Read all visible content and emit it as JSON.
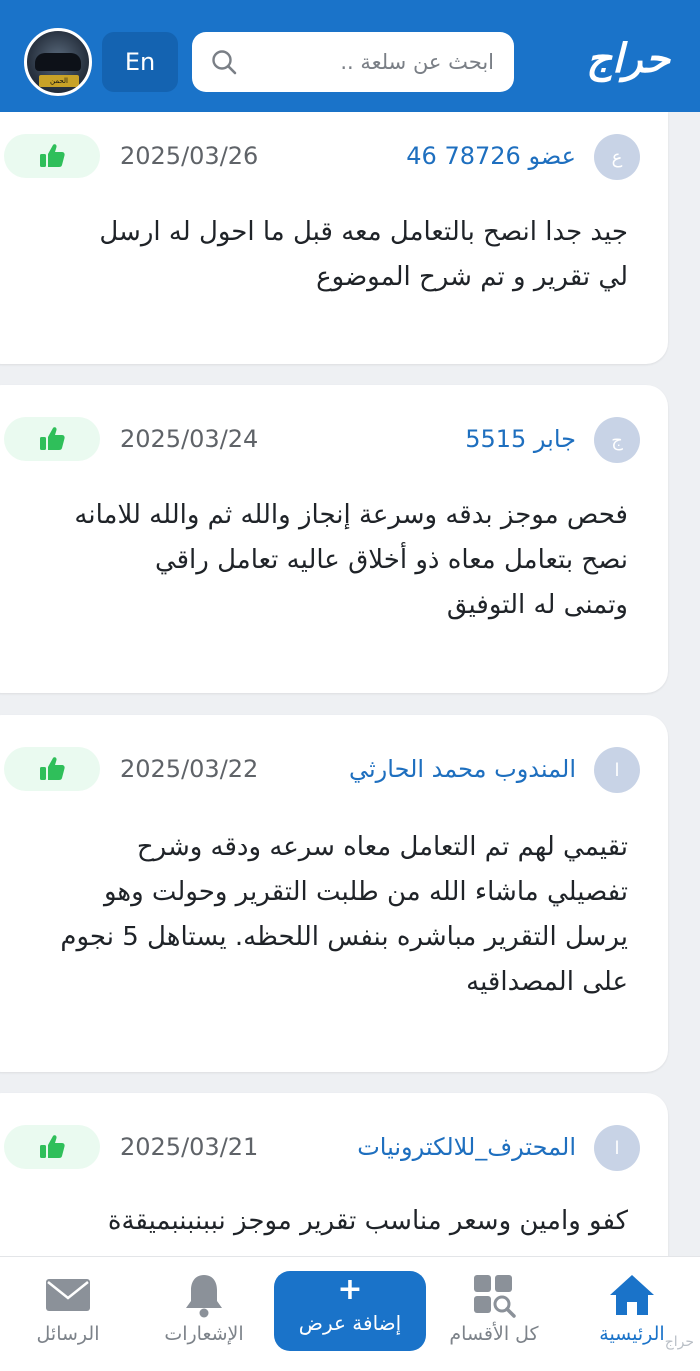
{
  "header": {
    "logo": "حراج",
    "search_placeholder": "ابحث عن سلعة ..",
    "lang_button": "En",
    "brand_color": "#1a73c9",
    "avatar_tag": "الحمن"
  },
  "reviews": [
    {
      "avatar_letter": "ع",
      "username": "عضو 78726 46",
      "date": "2025/03/26",
      "lines": [
        "جيد جدا انصح بالتعامل معه قبل ما احول له ارسل",
        "لي تقرير و تم شرح الموضوع"
      ]
    },
    {
      "avatar_letter": "ج",
      "username": "جابر 5515",
      "date": "2025/03/24",
      "lines": [
        "فحص موجز بدقه وسرعة إنجاز والله ثم والله للامانه",
        "نصح بتعامل معاه ذو أخلاق عاليه تعامل راقي",
        "وتمنى له التوفيق"
      ]
    },
    {
      "avatar_letter": "ا",
      "username": "المندوب محمد الحارثي",
      "date": "2025/03/22",
      "lines": [
        "تقيمي لهم تم التعامل معاه سرعه ودقه وشرح",
        "تفصيلي ماشاء الله من طلبت التقرير وحولت وهو",
        "يرسل التقرير مباشره بنفس اللحظه. يستاهل 5 نجوم",
        "على المصداقيه"
      ]
    },
    {
      "avatar_letter": "ا",
      "username": "المحترف_للالكترونيات",
      "date": "2025/03/21",
      "lines": [
        "كفو وامين وسعر مناسب تقرير موجز نببنبنبميقةة"
      ]
    }
  ],
  "bottom_nav": {
    "home": "الرئيسية",
    "categories": "كل الأقسام",
    "add_plus": "+",
    "add_offer": "إضافة عرض",
    "notifications": "الإشعارات",
    "messages": "الرسائل"
  },
  "watermark": "حراج",
  "colors": {
    "link": "#1e6fbf",
    "like_badge_bg": "#eafaf0",
    "like_icon": "#2fbf5a"
  }
}
